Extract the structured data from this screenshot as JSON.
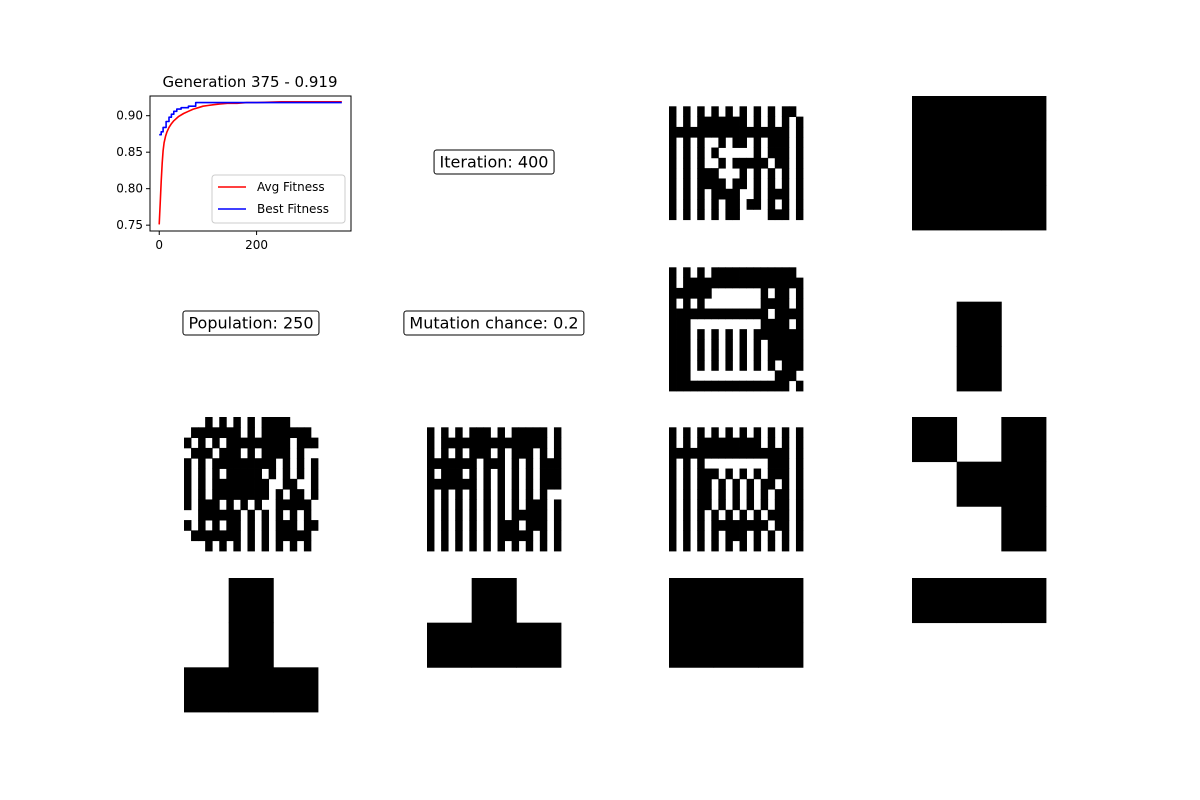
{
  "chart_data": {
    "type": "line",
    "title": "Generation 375 - 0.919",
    "xlabel": "",
    "ylabel": "",
    "xlim": [
      -19,
      394
    ],
    "ylim": [
      0.742,
      0.927
    ],
    "x_ticks": [
      0,
      200
    ],
    "y_ticks": [
      0.75,
      0.8,
      0.85,
      0.9
    ],
    "y_tick_labels": [
      "0.75",
      "0.80",
      "0.85",
      "0.90"
    ],
    "legend": "lower-right",
    "series": [
      {
        "name": "Avg Fitness",
        "color": "#ff0000",
        "x": [
          0,
          2,
          4,
          6,
          8,
          10,
          13,
          16,
          20,
          25,
          30,
          40,
          50,
          60,
          70,
          80,
          90,
          100,
          110,
          125,
          140,
          160,
          180,
          200,
          250,
          300,
          375
        ],
        "y": [
          0.751,
          0.78,
          0.81,
          0.835,
          0.852,
          0.863,
          0.872,
          0.878,
          0.884,
          0.889,
          0.893,
          0.899,
          0.903,
          0.906,
          0.909,
          0.911,
          0.913,
          0.914,
          0.915,
          0.916,
          0.917,
          0.917,
          0.918,
          0.918,
          0.919,
          0.919,
          0.919
        ]
      },
      {
        "name": "Best Fitness",
        "color": "#0000ff",
        "x": [
          0,
          4,
          4,
          8,
          8,
          14,
          14,
          20,
          20,
          25,
          25,
          30,
          30,
          36,
          36,
          45,
          45,
          60,
          60,
          75,
          75,
          375
        ],
        "y": [
          0.874,
          0.874,
          0.878,
          0.878,
          0.884,
          0.884,
          0.892,
          0.892,
          0.898,
          0.898,
          0.902,
          0.902,
          0.906,
          0.906,
          0.909,
          0.909,
          0.911,
          0.911,
          0.913,
          0.913,
          0.918,
          0.918
        ]
      }
    ]
  },
  "info": {
    "iteration": "Iteration: 400",
    "population": "Population: 250",
    "mutation": "Mutation chance: 0.2"
  },
  "colors": {
    "cell_on": "#000000",
    "cell_off": "#ffffff"
  },
  "grids": [
    {
      "name": "grid-r1-c3",
      "rows": [
        "0000000000000000000",
        "1010101010101010110",
        "1010111111101010101",
        "1111111111111111101",
        "1010100101101011101",
        "1010101000001011101",
        "1010100101111101101",
        "1010111000101010101",
        "1010111101101010101",
        "1010101111001011101",
        "1010101011011010101",
        "1010101011000011101",
        "0000000000000000000"
      ]
    },
    {
      "name": "grid-r1-c4",
      "rows": [
        "111",
        "111",
        "111"
      ]
    },
    {
      "name": "grid-r2-c3",
      "rows": [
        "0000000000000000000",
        "1010101111111111110",
        "1011111111111111111",
        "1111110000000101101",
        "1010100000000111101",
        "1111111111111101111",
        "1110000000000111101",
        "1110101010101111111",
        "1110101010101011111",
        "1110101010101011111",
        "1110101010101010111",
        "1110000000000001110",
        "1111111111111111101"
      ]
    },
    {
      "name": "grid-r2-c4",
      "rows": [
        "000",
        "010",
        "010"
      ]
    },
    {
      "name": "grid-r3-c1",
      "rows": [
        "0001010101011110000",
        "0111111101011111110",
        "1010101111111110111",
        "0111011101011110100",
        "1010111111111010101",
        "1010101111101010101",
        "1010111111110011001",
        "1010111111110101101",
        "1011101010100111110",
        "0011111101010101010",
        "1010101101010111011",
        "0111111101010111110",
        "0001010101010101010"
      ]
    },
    {
      "name": "grid-r3-c2",
      "rows": [
        "0000000000000000000",
        "1010101110101111101",
        "1011111111111111101",
        "1010101110101110101",
        "1111111011101010111",
        "1011101010101010111",
        "1111111010101010111",
        "1010101010101010100",
        "1010101010101011101",
        "1010101010101111101",
        "1010101010111011101",
        "1010101010111110101",
        "1010101010101010101"
      ]
    },
    {
      "name": "grid-r3-c3",
      "rows": [
        "0000000000000000000",
        "1010101010101010101",
        "1010111111111010101",
        "1111111111111111101",
        "1010100000000011101",
        "1010111010101011101",
        "1010110101010110101",
        "1010110101010101101",
        "1010110101010101101",
        "1010101010101011101",
        "1010101111111101101",
        "1010101011101010101",
        "1010101010101010101"
      ]
    },
    {
      "name": "grid-r3-c4",
      "rows": [
        "101",
        "011",
        "001"
      ]
    },
    {
      "name": "grid-r4-c1",
      "rows": [
        "010",
        "010",
        "111"
      ]
    },
    {
      "name": "grid-r4-c2",
      "rows": [
        "010",
        "111",
        "000"
      ]
    },
    {
      "name": "grid-r4-c3",
      "rows": [
        "111",
        "111",
        "000"
      ]
    },
    {
      "name": "grid-r4-c4",
      "rows": [
        "111",
        "000",
        "000"
      ]
    }
  ]
}
